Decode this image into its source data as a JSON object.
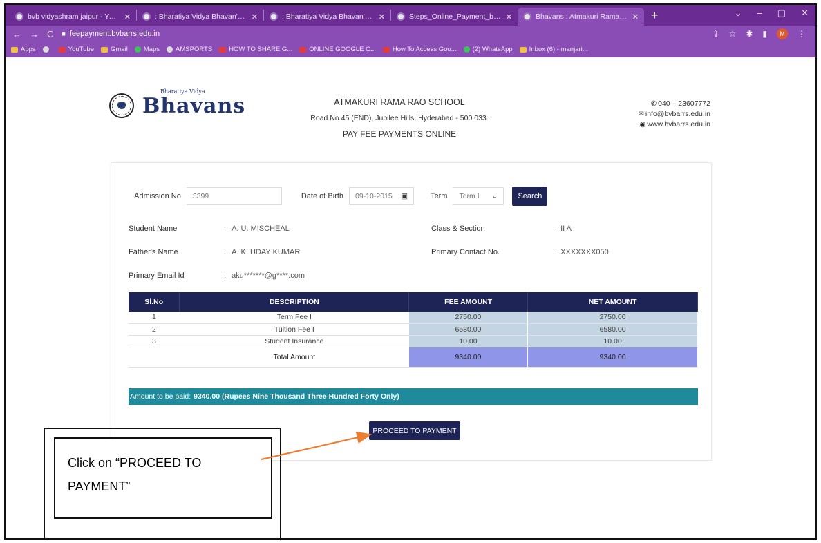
{
  "browser": {
    "tabs": [
      {
        "label": "bvb vidyashram jaipur - Yahoo S"
      },
      {
        "label": ": Bharatiya Vidya Bhavan's Vidya"
      },
      {
        "label": ": Bharatiya Vidya Bhavan's Vidya"
      },
      {
        "label": "Steps_Online_Payment_by_Brow"
      },
      {
        "label": "Bhavans : Atmakuri Rama Rao S",
        "active": true
      }
    ],
    "url": "feepayment.bvbarrs.edu.in",
    "bookmarks": [
      "Apps",
      "YouTube",
      "Gmail",
      "Maps",
      "AMSPORTS",
      "HOW TO SHARE G...",
      "ONLINE GOOGLE C...",
      "How To Access Goo...",
      "(2) WhatsApp",
      "Inbox (6) - manjari..."
    ],
    "profile_initial": "M"
  },
  "header": {
    "brand_small": "Bharatiya Vidya",
    "brand_name": "Bhavans",
    "school_name": "ATMAKURI RAMA RAO SCHOOL",
    "address": "Road No.45 (END), Jubilee Hills, Hyderabad - 500 033.",
    "subtitle": "PAY FEE PAYMENTS ONLINE",
    "phone": "040 – 23607772",
    "email": "info@bvbarrs.edu.in",
    "website": "www.bvbarrs.edu.in"
  },
  "search": {
    "admission_label": "Admission No",
    "admission_value": "3399",
    "dob_label": "Date of Birth",
    "dob_value": "09-10-2015",
    "term_label": "Term",
    "term_value": "Term I",
    "search_label": "Search"
  },
  "student": {
    "name_label": "Student Name",
    "name_value": "A. U. MISCHEAL",
    "class_label": "Class & Section",
    "class_value": "II A",
    "father_label": "Father's Name",
    "father_value": "A. K. UDAY KUMAR",
    "contact_label": "Primary Contact No.",
    "contact_value": "XXXXXXX050",
    "email_label": "Primary Email Id",
    "email_value": "aku*******@g****.com"
  },
  "fee_table": {
    "headers": [
      "Sl.No",
      "DESCRIPTION",
      "FEE AMOUNT",
      "NET AMOUNT"
    ],
    "rows": [
      [
        "1",
        "Term Fee I",
        "2750.00",
        "2750.00"
      ],
      [
        "2",
        "Tuition Fee I",
        "6580.00",
        "6580.00"
      ],
      [
        "3",
        "Student Insurance",
        "10.00",
        "10.00"
      ]
    ],
    "total_label": "Total Amount",
    "total_fee": "9340.00",
    "total_net": "9340.00"
  },
  "amount_bar": {
    "prefix": "Amount to be paid:",
    "value": "9340.00 (Rupees Nine Thousand Three Hundred Forty Only)"
  },
  "proceed_label": "PROCEED TO PAYMENT",
  "callout": {
    "text": "Click on “PROCEED TO PAYMENT”",
    "arrow_color": "#ed7d31"
  }
}
